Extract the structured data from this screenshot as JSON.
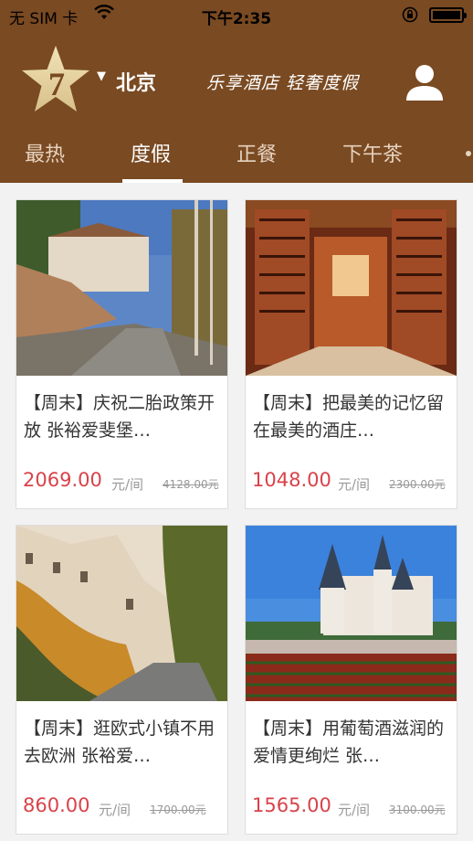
{
  "status_bar": {
    "carrier": "无 SIM 卡",
    "time": "下午2:35"
  },
  "header": {
    "logo_number": "7",
    "city": "北京",
    "slogan": "乐享酒店 轻奢度假",
    "icons": [
      "wifi-icon",
      "orientation-lock-icon",
      "battery-icon",
      "star-logo",
      "dropdown-arrow-icon",
      "user-icon"
    ]
  },
  "tabs": [
    "最热",
    "度假",
    "正餐",
    "下午茶"
  ],
  "active_tab": "度假",
  "cards": [
    {
      "title": "【周末】庆祝二胎政策开放 张裕爱斐堡…",
      "price": "2069.00",
      "unit": "元/间",
      "original_price": "4128.00元",
      "image": "chateau hillside road"
    },
    {
      "title": "【周末】把最美的记忆留在最美的酒庄…",
      "price": "1048.00",
      "unit": "元/间",
      "original_price": "2300.00元",
      "image": "wine cellar"
    },
    {
      "title": "【周末】逛欧式小镇不用去欧洲 张裕爱…",
      "price": "860.00",
      "unit": "元/间",
      "original_price": "1700.00元",
      "image": "european building autumn"
    },
    {
      "title": "【周末】用葡萄酒滋润的爱情更绚烂 张…",
      "price": "1565.00",
      "unit": "元/间",
      "original_price": "3100.00元",
      "image": "castle vineyard"
    }
  ]
}
